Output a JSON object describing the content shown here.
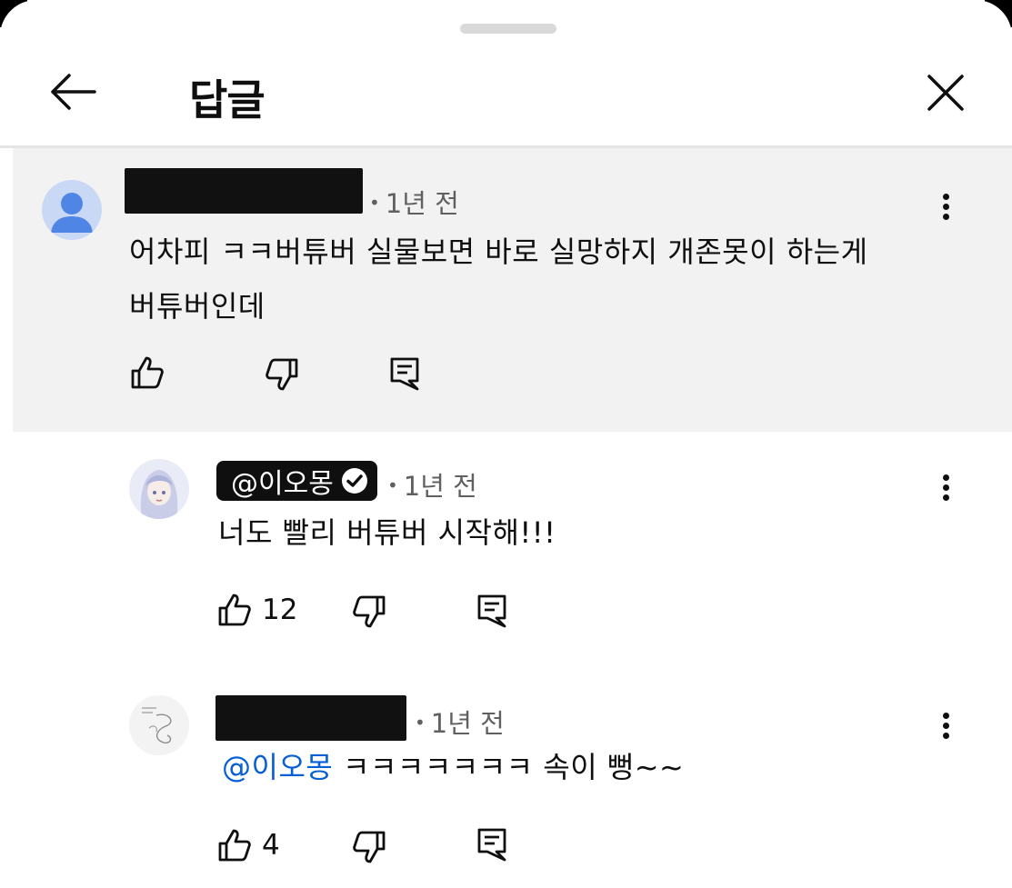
{
  "header": {
    "title": "답글"
  },
  "parent_comment": {
    "time": "1년 전",
    "text_line1": "어차피 ㅋㅋ버튜버 실물보면 바로 실망하지 개존못이 하는게",
    "text_line2": "버튜버인데"
  },
  "replies": [
    {
      "handle": "@이오몽",
      "verified": true,
      "time": "1년 전",
      "text": "너도 빨리 버튜버 시작해!!!",
      "likes": "12"
    },
    {
      "time": "1년 전",
      "mention": "@이오몽",
      "text": "ㅋㅋㅋㅋㅋㅋㅋ 속이 뻥~~",
      "likes": "4"
    }
  ],
  "icons": {
    "back": "back-arrow-icon",
    "close": "close-icon",
    "more": "more-vertical-icon",
    "like": "thumbs-up-icon",
    "dislike": "thumbs-down-icon",
    "reply": "reply-comment-icon",
    "verified": "verified-check-icon"
  },
  "colors": {
    "highlight_bg": "#f2f2f2",
    "mention": "#065fd4",
    "default_avatar": "#4f86e6",
    "badge_bg": "#0f0f0f"
  }
}
